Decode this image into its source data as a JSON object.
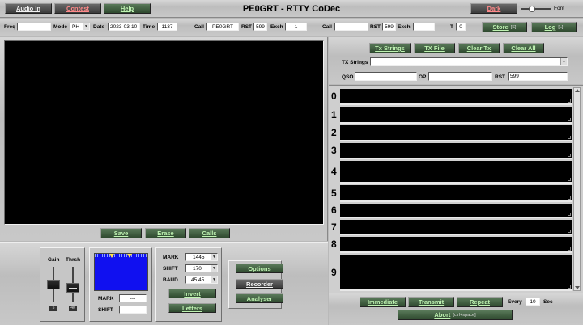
{
  "title": "PE0GRT - RTTY CoDec",
  "menu": {
    "audio_in": "Audio In",
    "contest": "Contest",
    "help": "Help",
    "dark": "Dark",
    "font": "Font"
  },
  "log": {
    "freq_label": "Freq",
    "freq": "",
    "mode_label": "Mode",
    "mode": "PH",
    "date_label": "Date",
    "date": "2023-03-10",
    "time_label": "Time",
    "time": "1137",
    "call_label": "Call",
    "call": "PE0GRT",
    "rst_label": "RST",
    "rst": "599",
    "exch_label": "Exch",
    "exch": "1",
    "call2_label": "Call",
    "call2": "",
    "rst2_label": "RST",
    "rst2": "599",
    "exch2_label": "Exch",
    "exch2": "",
    "t_label": "T",
    "t": "0",
    "store": "Store",
    "store_key": "[S]",
    "log": "Log",
    "log_key": "[L]"
  },
  "rx_buttons": {
    "save": "Save",
    "erase": "Erase",
    "calls": "Calls"
  },
  "tx": {
    "tx_strings_btn": "Tx Strings",
    "tx_file": "TX File",
    "clear_tx": "Clear Tx",
    "clear_all": "Clear All",
    "tx_strings_label": "TX Strings",
    "tx_strings_value": "",
    "qso_label": "QSO",
    "qso": "",
    "op_label": "OP",
    "op": "",
    "rst_label": "RST",
    "rst": "599"
  },
  "rows": [
    "0",
    "1",
    "2",
    "3",
    "4",
    "5",
    "6",
    "7",
    "8",
    "9"
  ],
  "controls": {
    "gain_label": "Gain",
    "thrsh_label": "Thrsh",
    "gain_value": "5",
    "thrsh_value": "40",
    "mark_label": "MARK",
    "mark_value": "---",
    "shift_label": "SHIFT",
    "shift_value": "---",
    "mark_sel_label": "MARK",
    "mark_sel": "1445",
    "shift_sel_label": "SHIFT",
    "shift_sel": "170",
    "baud_label": "BAUD",
    "baud_sel": "45.45",
    "invert": "Invert",
    "letters": "Letters",
    "options": "Options",
    "recorder": "Recorder",
    "analyser": "Analyser"
  },
  "tx_controls": {
    "immediate": "Immediate",
    "transmit": "Transmit",
    "repeat": "Repeat",
    "every_label": "Every",
    "every": "10",
    "sec_label": "Sec",
    "abort": "Abort",
    "abort_key": "[ctrl+space]"
  },
  "colors": {
    "spectrum": "#1010f0",
    "accent_green": "#bff3b2",
    "contest_red": "#ff8a8a"
  }
}
